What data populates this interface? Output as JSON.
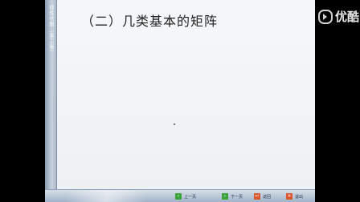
{
  "slide": {
    "title": "（二）几类基本的矩阵"
  },
  "side_rail": {
    "text": "线性代数（第三版）"
  },
  "nav": {
    "prev_label": "上一页",
    "next_label": "下一页",
    "back_label": "返回",
    "exit_label": "退出"
  },
  "watermark": {
    "text": "优酷"
  },
  "colors": {
    "background": "#000000",
    "slide_bg": "#eef1f5",
    "rail": "#aebbc9",
    "nav_icon_green": "#3aa33a",
    "nav_icon_red": "#d9572b"
  }
}
